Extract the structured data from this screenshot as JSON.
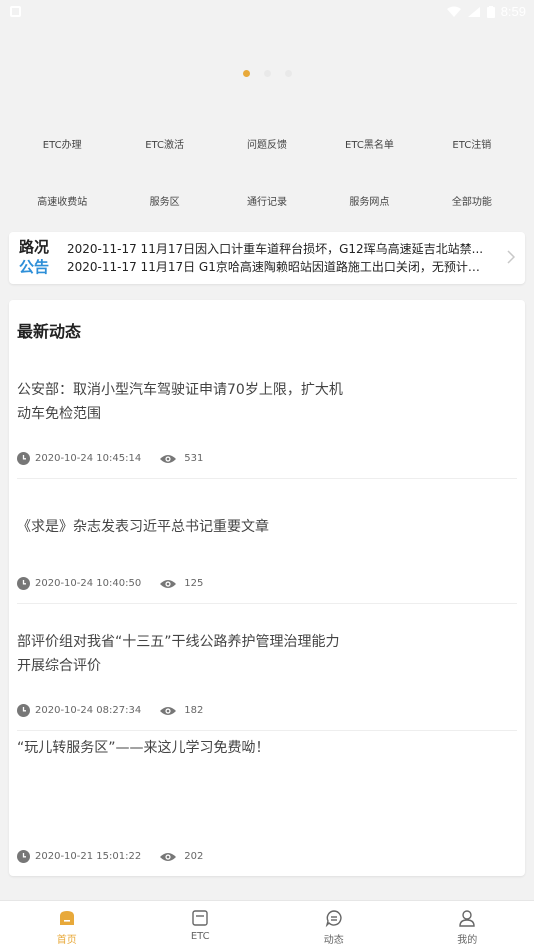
{
  "status_bar": {
    "time": "8:59"
  },
  "carousel": {
    "dot_count": 3,
    "active_index": 0
  },
  "quick_actions": {
    "row1": [
      "ETC办理",
      "ETC激活",
      "问题反馈",
      "ETC黑名单",
      "ETC注销"
    ],
    "row2": [
      "高速收费站",
      "服务区",
      "通行记录",
      "服务网点",
      "全部功能"
    ]
  },
  "notice": {
    "logo_top": "路况",
    "logo_bottom": "公告",
    "items": [
      "2020-11-17  11月17日因入口计重车道秤台损坏，G12珲乌高速延吉北站禁...",
      "2020-11-17  11月17日 G1京哈高速陶赖昭站因道路施工出口关闭，无预计恢..."
    ]
  },
  "news_section": {
    "title": "最新动态",
    "items": [
      {
        "title": "公安部：取消小型汽车驾驶证申请70岁上限，扩大机动车免检范围",
        "time": "2020-10-24 10:45:14",
        "views": "531"
      },
      {
        "title": "《求是》杂志发表习近平总书记重要文章",
        "time": "2020-10-24 10:40:50",
        "views": "125"
      },
      {
        "title": "部评价组对我省“十三五”干线公路养护管理治理能力开展综合评价",
        "time": "2020-10-24 08:27:34",
        "views": "182"
      },
      {
        "title": "“玩儿转服务区”——来这儿学习免费呦！",
        "time": "2020-10-21 15:01:22",
        "views": "202"
      }
    ]
  },
  "tab_bar": {
    "tabs": [
      {
        "label": "首页",
        "icon": "home-icon",
        "active": true
      },
      {
        "label": "ETC",
        "icon": "etc-card-icon",
        "active": false
      },
      {
        "label": "动态",
        "icon": "message-icon",
        "active": false
      },
      {
        "label": "我的",
        "icon": "user-icon",
        "active": false
      }
    ]
  },
  "colors": {
    "accent": "#e8a93a",
    "notice_blue": "#2e8fd8",
    "background": "#f2f2f2"
  }
}
